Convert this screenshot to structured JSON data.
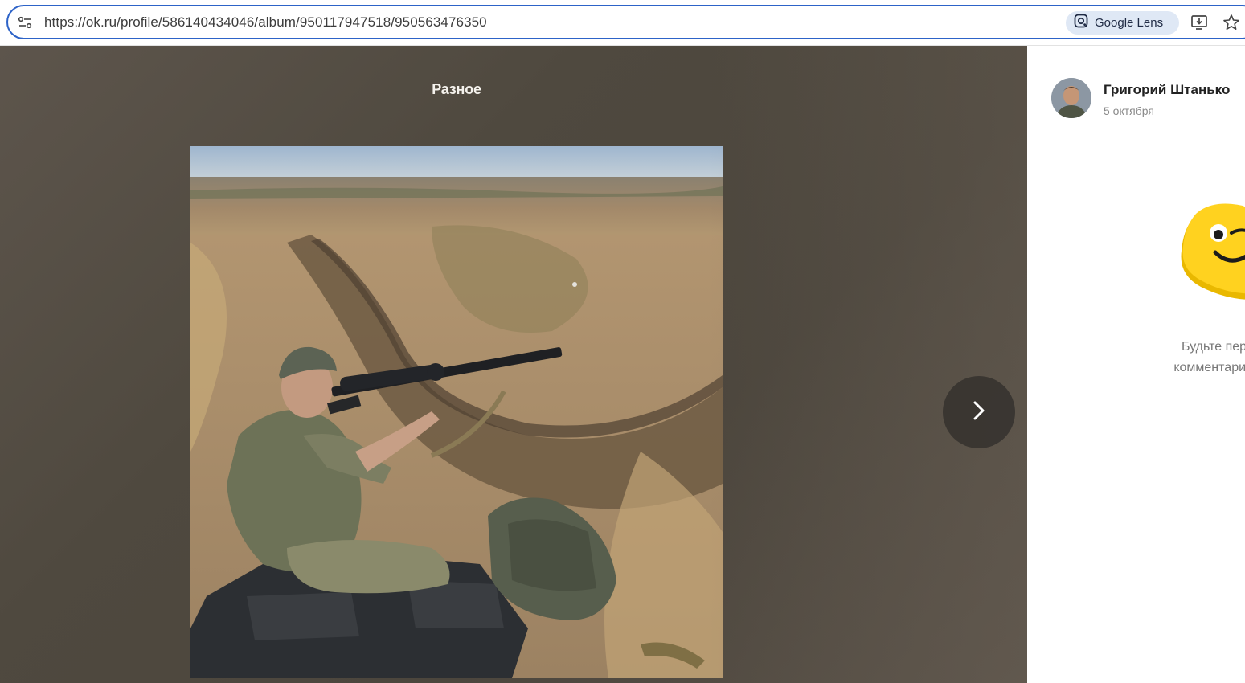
{
  "browser": {
    "url": "https://ok.ru/profile/586140434046/album/950117947518/950563476350",
    "lens_label": "Google Lens",
    "icons": {
      "site_info": "tune-icon",
      "lens": "google-lens-icon",
      "install": "install-app-icon",
      "bookmark": "star-icon"
    }
  },
  "viewer": {
    "album_title": "Разное",
    "next_icon": "chevron-right-icon"
  },
  "side_panel": {
    "author_name": "Григорий Штанько",
    "post_date": "5 октября",
    "empty_comments_line1": "Будьте первым, к",
    "empty_comments_line2": "комментарий к этой",
    "mascot_icon": "ok-mascot-wink-icon"
  },
  "colors": {
    "omnibox_border": "#2d63c8",
    "lens_chip_bg": "#dfe8f5",
    "viewer_bg": "#4f493f",
    "mascot_yellow": "#ffd21f"
  }
}
